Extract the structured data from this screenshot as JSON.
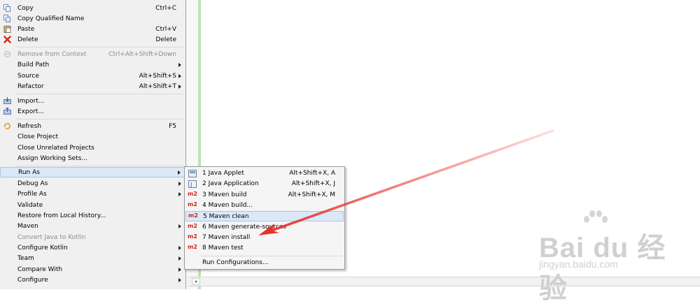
{
  "context_menu": {
    "items": [
      {
        "label": "Copy",
        "shortcut": "Ctrl+C",
        "icon": "copy-icon"
      },
      {
        "label": "Copy Qualified Name",
        "shortcut": "",
        "icon": "copy-qualified-icon"
      },
      {
        "label": "Paste",
        "shortcut": "Ctrl+V",
        "icon": "paste-icon"
      },
      {
        "label": "Delete",
        "shortcut": "Delete",
        "icon": "delete-icon"
      },
      {
        "label": "Remove from Context",
        "shortcut": "Ctrl+Alt+Shift+Down",
        "icon": "remove-context-icon"
      },
      {
        "label": "Build Path",
        "shortcut": ""
      },
      {
        "label": "Source",
        "shortcut": "Alt+Shift+S"
      },
      {
        "label": "Refactor",
        "shortcut": "Alt+Shift+T"
      },
      {
        "label": "Import...",
        "shortcut": "",
        "icon": "import-icon"
      },
      {
        "label": "Export...",
        "shortcut": "",
        "icon": "export-icon"
      },
      {
        "label": "Refresh",
        "shortcut": "F5",
        "icon": "refresh-icon"
      },
      {
        "label": "Close Project",
        "shortcut": ""
      },
      {
        "label": "Close Unrelated Projects",
        "shortcut": ""
      },
      {
        "label": "Assign Working Sets...",
        "shortcut": ""
      },
      {
        "label": "Run As",
        "shortcut": ""
      },
      {
        "label": "Debug As",
        "shortcut": ""
      },
      {
        "label": "Profile As",
        "shortcut": ""
      },
      {
        "label": "Validate",
        "shortcut": ""
      },
      {
        "label": "Restore from Local History...",
        "shortcut": ""
      },
      {
        "label": "Maven",
        "shortcut": ""
      },
      {
        "label": "Convert Java to Kotlin",
        "shortcut": ""
      },
      {
        "label": "Configure Kotlin",
        "shortcut": ""
      },
      {
        "label": "Team",
        "shortcut": ""
      },
      {
        "label": "Compare With",
        "shortcut": ""
      },
      {
        "label": "Configure",
        "shortcut": ""
      }
    ]
  },
  "run_as_submenu": {
    "items": [
      {
        "label": "1 Java Applet",
        "shortcut": "Alt+Shift+X, A",
        "icon": "java-applet-icon"
      },
      {
        "label": "2 Java Application",
        "shortcut": "Alt+Shift+X, J",
        "icon": "java-application-icon"
      },
      {
        "label": "3 Maven build",
        "shortcut": "Alt+Shift+X, M",
        "icon": "m2"
      },
      {
        "label": "4 Maven build...",
        "shortcut": "",
        "icon": "m2"
      },
      {
        "label": "5 Maven clean",
        "shortcut": "",
        "icon": "m2"
      },
      {
        "label": "6 Maven generate-sources",
        "shortcut": "",
        "icon": "m2"
      },
      {
        "label": "7 Maven install",
        "shortcut": "",
        "icon": "m2"
      },
      {
        "label": "8 Maven test",
        "shortcut": "",
        "icon": "m2"
      },
      {
        "label": "Run Configurations...",
        "shortcut": ""
      }
    ]
  },
  "watermark": {
    "brand": "Bai du 经验",
    "url": "jingyan.baidu.com"
  },
  "colors": {
    "highlight": "#dbe8f8",
    "m2": "#d21e1e",
    "arrow": "#e8322d",
    "gutter": "#bfe3b4"
  }
}
